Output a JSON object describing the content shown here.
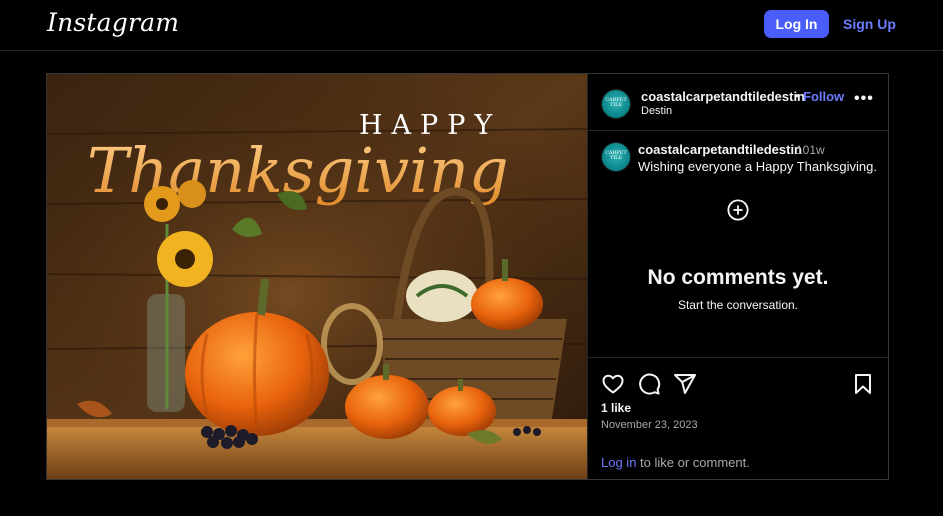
{
  "header": {
    "logo": "Instagram",
    "login_label": "Log In",
    "signup_label": "Sign Up"
  },
  "post": {
    "image_text": {
      "happy": "HAPPY",
      "thanksgiving": "Thanksgiving"
    },
    "author": {
      "username": "coastalcarpetandtiledestin",
      "location": "Destin",
      "follow_label": "Follow",
      "separator": "•"
    },
    "caption": {
      "username": "coastalcarpetandtiledestin",
      "time_ago": "101w",
      "text": "Wishing everyone a Happy Thanksgiving."
    },
    "comments": {
      "empty_title": "No comments yet.",
      "empty_subtitle": "Start the conversation."
    },
    "stats": {
      "likes": "1 like",
      "date": "November 23, 2023"
    },
    "login_prompt": {
      "link": "Log in",
      "rest": " to like or comment."
    }
  },
  "icons": [
    "heart-icon",
    "comment-icon",
    "share-icon",
    "bookmark-icon",
    "add-comment-icon",
    "more-options-icon"
  ],
  "colors": {
    "accent": "#4a5df9",
    "link": "#6c7cff",
    "background": "#000000",
    "text": "#f5f5f5",
    "secondary_text": "#a8a8a8"
  }
}
